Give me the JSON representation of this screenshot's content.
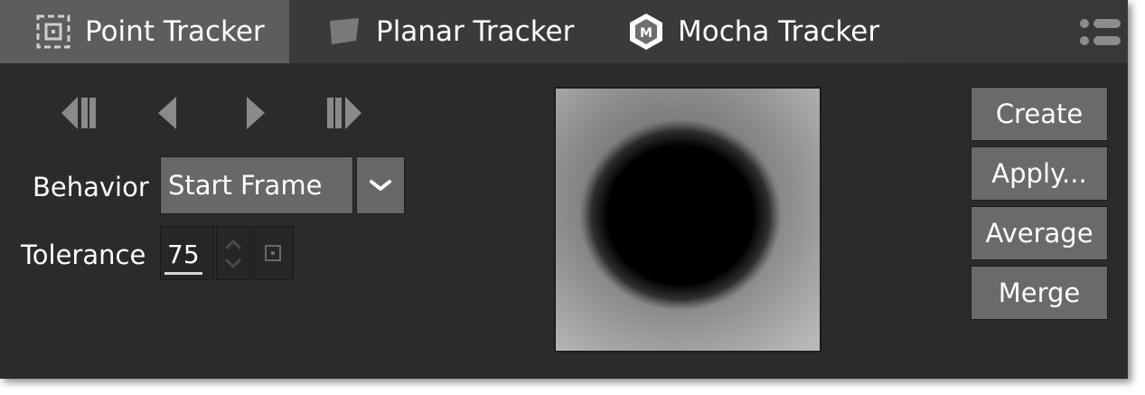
{
  "tabs": [
    {
      "label": "Point Tracker",
      "icon": "point-tracker-icon",
      "selected": true
    },
    {
      "label": "Planar Tracker",
      "icon": "planar-tracker-icon",
      "selected": false
    },
    {
      "label": "Mocha Tracker",
      "icon": "mocha-icon",
      "selected": false
    }
  ],
  "menu_icon": "panel-menu-icon",
  "navigation": [
    "step-back-icon",
    "play-backward-icon",
    "play-forward-icon",
    "step-forward-icon"
  ],
  "behavior": {
    "label": "Behavior",
    "value": "Start Frame"
  },
  "tolerance": {
    "label": "Tolerance",
    "value": "75"
  },
  "actions": {
    "create": "Create",
    "apply": "Apply...",
    "average": "Average",
    "merge": "Merge"
  },
  "colors": {
    "panel": "#2b2b2b",
    "tab_selected": "#5d5d5d",
    "button": "#6a6a6a"
  }
}
